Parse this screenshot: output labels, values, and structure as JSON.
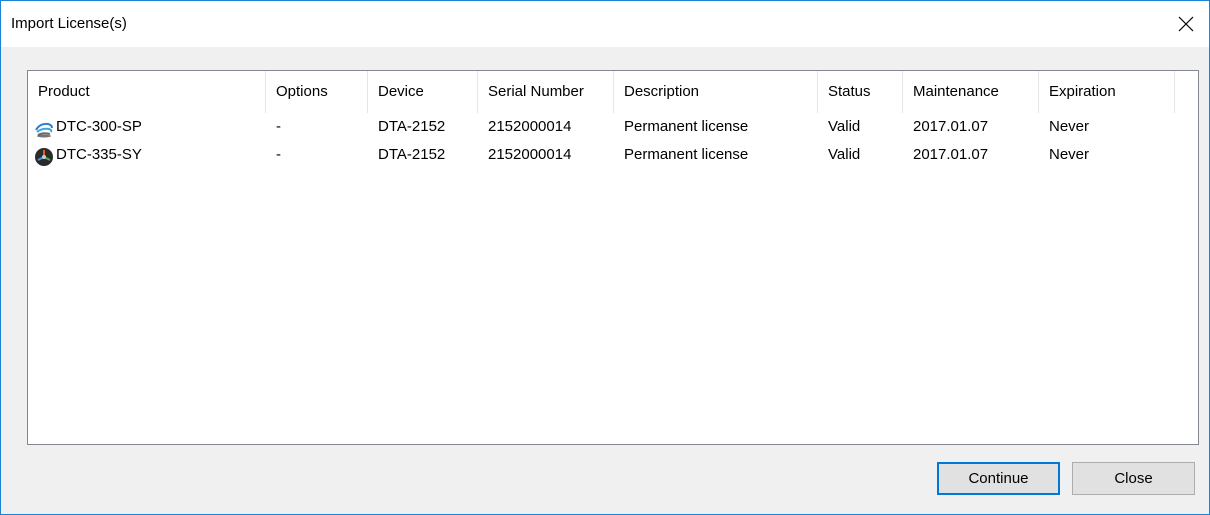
{
  "window": {
    "title": "Import License(s)"
  },
  "table": {
    "columns": [
      "Product",
      "Options",
      "Device",
      "Serial Number",
      "Description",
      "Status",
      "Maintenance",
      "Expiration"
    ],
    "rows": [
      {
        "icon": "dtc-300-product-icon",
        "cells": [
          "DTC-300-SP",
          "-",
          "DTA-2152",
          "2152000014",
          "Permanent license",
          "Valid",
          "2017.01.07",
          "Never"
        ]
      },
      {
        "icon": "dtc-335-product-icon",
        "cells": [
          "DTC-335-SY",
          "-",
          "DTA-2152",
          "2152000014",
          "Permanent license",
          "Valid",
          "2017.01.07",
          "Never"
        ]
      }
    ]
  },
  "buttons": {
    "continue_label": "Continue",
    "close_label": "Close"
  },
  "colors": {
    "window_border": "#1883d7",
    "default_button_border": "#0078d7",
    "background": "#f0f0f0"
  }
}
